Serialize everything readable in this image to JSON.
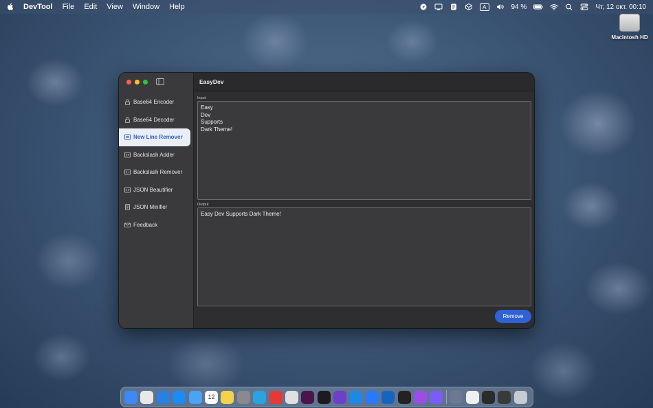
{
  "menubar": {
    "app_name": "DevTool",
    "menus": [
      "File",
      "Edit",
      "View",
      "Window",
      "Help"
    ],
    "battery": "94 %",
    "datetime": "Чт, 12 окт.  00:10",
    "input_source": "A"
  },
  "desktop": {
    "disk_label": "Macintosh HD"
  },
  "window": {
    "title": "EasyDev",
    "sidebar": {
      "items": [
        {
          "label": "Base64 Encoder",
          "icon": "lock-icon"
        },
        {
          "label": "Base64 Decoder",
          "icon": "unlock-icon"
        },
        {
          "label": "New Line Remover",
          "icon": "newline-icon",
          "active": true
        },
        {
          "label": "Backslash Adder",
          "icon": "backslash-add-icon"
        },
        {
          "label": "Backslash Remover",
          "icon": "backslash-remove-icon"
        },
        {
          "label": "JSON Beautifier",
          "icon": "json-icon"
        },
        {
          "label": "JSON Minifier",
          "icon": "json-min-icon"
        },
        {
          "label": "Feedback",
          "icon": "envelope-icon"
        }
      ]
    },
    "input": {
      "label": "Input",
      "value": "Easy\nDev\nSupports\nDark Theme!"
    },
    "output": {
      "label": "Output",
      "value": "Easy Dev Supports Dark Theme!"
    },
    "remove_button": "Remove"
  },
  "dock": {
    "apps": [
      {
        "name": "finder",
        "color": "#3d8bf2"
      },
      {
        "name": "launchpad",
        "color": "#e8e8e8"
      },
      {
        "name": "safari",
        "color": "#2a7fe0"
      },
      {
        "name": "app-store",
        "color": "#1b8bf5"
      },
      {
        "name": "mail",
        "color": "#4aa3f5"
      },
      {
        "name": "calendar",
        "color": "#ffffff",
        "text": "12"
      },
      {
        "name": "notes",
        "color": "#f6d24c"
      },
      {
        "name": "system-settings",
        "color": "#8a8a8e"
      },
      {
        "name": "telegram",
        "color": "#2aa3e0"
      },
      {
        "name": "youtube-music",
        "color": "#e53935"
      },
      {
        "name": "chrome",
        "color": "#e0e0e0"
      },
      {
        "name": "slack",
        "color": "#4a154b"
      },
      {
        "name": "terminal",
        "color": "#1c1c1e"
      },
      {
        "name": "github-desktop",
        "color": "#6e40c9"
      },
      {
        "name": "vscode",
        "color": "#1e88e5"
      },
      {
        "name": "xcode",
        "color": "#2979ff"
      },
      {
        "name": "instruments",
        "color": "#1565c0"
      },
      {
        "name": "keyboard-app",
        "color": "#222222"
      },
      {
        "name": "podcasts",
        "color": "#9b4ee6"
      },
      {
        "name": "devtool",
        "color": "#7b5cf5"
      },
      {
        "name": "preview",
        "color": "#6b7a90"
      },
      {
        "name": "document",
        "color": "#f0f0f0"
      },
      {
        "name": "activity-monitor",
        "color": "#2b2b2b"
      },
      {
        "name": "screens",
        "color": "#3a3a3a"
      },
      {
        "name": "trash",
        "color": "#c7ccd3"
      }
    ]
  },
  "colors": {
    "accent": "#2f62d6",
    "active_item_bg": "#e9eef7",
    "active_item_text": "#2e5fc8"
  }
}
